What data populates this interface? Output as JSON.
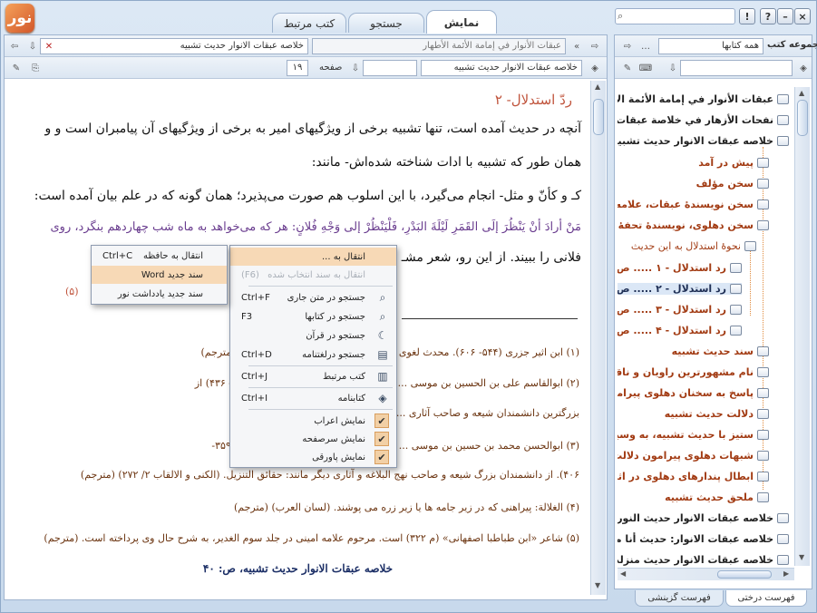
{
  "app": {
    "logo_text": "نور"
  },
  "tabs": [
    {
      "label": "نمایش",
      "active": true
    },
    {
      "label": "جستجو",
      "active": false
    },
    {
      "label": "کتب مرتبط",
      "active": false
    }
  ],
  "window_buttons": {
    "close": "×",
    "help": "?",
    "alert": "!"
  },
  "doc_toolbar": {
    "tab_right_title": "عبقات الأنوار في إمامة الأئمة الأطهار",
    "tab_left_title": "خلاصه عبقات الانوار حديث تشبيه",
    "book_field": "خلاصه عبقات الانوار حديث تشبيه",
    "page_label": "صفحه",
    "page_value": "۱۹"
  },
  "content": {
    "heading": "ردّ استدلال- ۲",
    "paragraphs": [
      "آنچه در حديث آمده است، تنها تشبيه برخى از ويژگيهاى امير به برخى از ويژگيهاى آن پيامبران است و و",
      "همان طور كه تشبيه با ادات شناخته شده‌اش- مانند:",
      "كـ و كأنّ و مثل- انجام مى‌گيرد، با اين اسلوب هم صورت مى‌پذيرد؛ همان گونه كه در علم بيان آمده است:",
      "مَنْ أرادَ أنْ يَنْظُرَ إلَى القَمَرِ لَيْلَةَ البَدْرِ، فَلْيَنْظُرْ إلى وَجْهِ فُلانٍ: هر كه مى‌خواهد به ماه شب چهاردهم بنگرد، روى",
      "فلانى را ببيند. از اين رو، شعر مشـ"
    ],
    "verse_line": "لاتـعـجـبـوا مـن بـلـىٰ غـلـ",
    "verse_marker": "(۵)",
    "footnotes": [
      "(۱) ابن اثير جزرى (۵۴۴- ۶۰۶). محدث لغوى ... في غريب الحديث. (الاعلام ۵/ ۲۷۲) (مترجم)",
      "(۲) ابوالقاسم على بن الحسين بن موسى ... مشهور به سيد مرتضى علم الهدى (۳۵۵- ۴۳۶) از",
      "بزرگترين دانشمندان شيعه و صاحب آثارى ... و الالقاب ۲/ ۴۸۰) (مترجم)",
      "(۳) ابوالحسن محمد بن حسين بن موسى ... موسى كاظم (ع) مشهور به سيد رضى (۳۵۹-",
      "۴۰۶). از دانشمندان بزرگ شيعه و صاحب نهج البلاغه و آثارى ديگر مانند: حقائق التنزيل. (الكنى و الالقاب ۲/ ۲۷۲) (مترجم)",
      "(۴) الغلالة: پيراهنى كه در زير جامه ها يا زير زره مى پوشند. (لسان العرب) (مترجم)",
      "(۵) شاعر «ابن طباطبا اصفهانى» (م ۳۲۲) است. مرحوم علامه امينى در جلد سوم الغدير، به شرح حال وى پرداخته است. (مترجم)"
    ],
    "page_footer": "خلاصه عبقات الانوار حديث تشبيه، ص: ۴۰"
  },
  "context_menu": {
    "items": [
      {
        "label": "انتقال به ...",
        "shortcut": "",
        "icon": "",
        "disabled": false,
        "highlighted": true
      },
      {
        "label": "انتقال به سند انتخاب شده",
        "shortcut": "(F6)",
        "icon": "",
        "disabled": true
      },
      {
        "label": "جستجو در متن جارى",
        "shortcut": "Ctrl+F",
        "icon": "search-icon"
      },
      {
        "label": "جستجو در كتابها",
        "shortcut": "F3",
        "icon": "search-icon"
      },
      {
        "label": "جستجو در قرآن",
        "shortcut": "",
        "icon": "quran-icon"
      },
      {
        "label": "جستجو درلغتنامه",
        "shortcut": "Ctrl+D",
        "icon": "dictionary-icon"
      },
      {
        "label": "كتب مرتبط",
        "shortcut": "Ctrl+J",
        "icon": "related-books-icon"
      },
      {
        "label": "كتابنامه",
        "shortcut": "Ctrl+I",
        "icon": "bibliography-icon"
      },
      {
        "label": "نمايش اعراب",
        "checked": true
      },
      {
        "label": "نمايش سرصفحه",
        "checked": true
      },
      {
        "label": "نمايش پاورقى",
        "checked": true
      }
    ]
  },
  "submenu": {
    "items": [
      {
        "label": "انتقال به حافظه",
        "shortcut": "Ctrl+C"
      },
      {
        "label": "سند جديد Word",
        "shortcut": ""
      },
      {
        "label": "سند جديد يادداشت نور",
        "shortcut": ""
      }
    ]
  },
  "sidebar": {
    "collection_label": "مجموعه كتب",
    "collection_value": "همه كتابها",
    "tree": [
      {
        "label": "عبقات الأنوار في إمامة الأئمة الأطه",
        "level": 0
      },
      {
        "label": "نفحات الأزهار في خلاصة عبقات الأ",
        "level": 0
      },
      {
        "label": "خلاصه عبقات الانوار حديث تشبيه",
        "level": 0
      },
      {
        "label": "پيش در آمد",
        "level": 1
      },
      {
        "label": "سخن مؤلف",
        "level": 1
      },
      {
        "label": "سخن نويسندهٔ عبقات، علامه مير",
        "level": 1
      },
      {
        "label": "سخن دهلوى، نويسندهٔ تحفهٔ اث",
        "level": 1
      },
      {
        "label": "نحوهٔ استدلال به اين حديث",
        "level": 2
      },
      {
        "label": "رد استدلال - ۱ ..... ص",
        "level": 3
      },
      {
        "label": "رد استدلال - ۲ ..... ص",
        "level": 3,
        "selected": true
      },
      {
        "label": "رد استدلال - ۳ ..... ص",
        "level": 3
      },
      {
        "label": "رد استدلال - ۴ ..... ص",
        "level": 3
      },
      {
        "label": "سند حديث تشبيه",
        "level": 1
      },
      {
        "label": "نام مشهورترين راويان و ناقلان",
        "level": 1
      },
      {
        "label": "پاسخ به سخنان دهلوى پيرامون",
        "level": 1
      },
      {
        "label": "دلالت حديث تشبيه",
        "level": 1
      },
      {
        "label": "ستيز با حديث تشبيه، به وسيلهٔ",
        "level": 1
      },
      {
        "label": "شبهات دهلوى پيرامون دلالت ح",
        "level": 1
      },
      {
        "label": "ابطال پندارهاى دهلوى در اثبات",
        "level": 1
      },
      {
        "label": "ملحق حديث تشبيه",
        "level": 1
      },
      {
        "label": "خلاصه عبقات الانوار حديث النور",
        "level": 0
      },
      {
        "label": "خلاصه عبقات الانوار: حديث أنا مد",
        "level": 0
      },
      {
        "label": "خلاصه عبقات الانوار حديث منزلت",
        "level": 0
      }
    ],
    "bottom_tabs": [
      {
        "label": "فهرست درختى",
        "active": true
      },
      {
        "label": "فهرست گزينشى",
        "active": false
      }
    ]
  }
}
